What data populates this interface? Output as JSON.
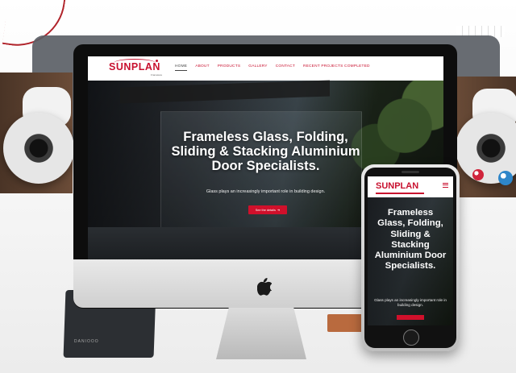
{
  "site": {
    "logo": "SUNPLAN",
    "logo_sub": "Frameless",
    "nav": [
      "HOME",
      "ABOUT",
      "PRODUCTS",
      "GALLERY",
      "CONTACT",
      "RECENT PROJECTS COMPLETED"
    ],
    "active_nav": "HOME",
    "hero_title": "Frameless Glass, Folding, Sliding & Stacking Aluminium Door Specialists.",
    "hero_subtitle": "Glass plays an increasingly important role in building design.",
    "hero_button": "See the details",
    "accent_color": "#c8102e"
  },
  "phone": {
    "logo": "SUNPLAN",
    "hero_title": "Frameless Glass, Folding, Sliding & Stacking Aluminium Door Specialists.",
    "hero_subtitle": "Glass plays an increasingly important role in building design."
  },
  "scene": {
    "tablet_label": "DANIOOO"
  }
}
